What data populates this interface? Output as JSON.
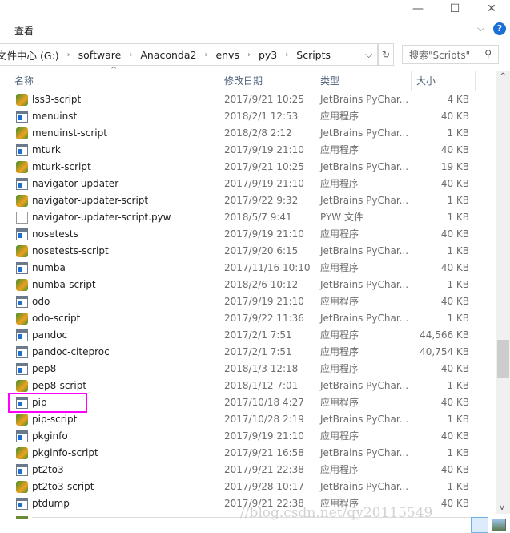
{
  "window": {
    "minimize": "—",
    "maximize": "☐",
    "close": "✕"
  },
  "ribbon": {
    "tab": "查看",
    "collapse": "⌵",
    "help": "?"
  },
  "address": {
    "crumbs": [
      "文件中心 (G:)",
      "software",
      "Anaconda2",
      "envs",
      "py3",
      "Scripts"
    ],
    "dropdown": "⌵",
    "refresh": "↻"
  },
  "search": {
    "placeholder": "搜索\"Scripts\""
  },
  "columns": {
    "name": "名称",
    "date": "修改日期",
    "type": "类型",
    "size": "大小"
  },
  "files": [
    {
      "name": "lss3-script",
      "date": "2017/9/21 10:25",
      "type": "JetBrains PyChar...",
      "size": "4 KB",
      "icon": "py"
    },
    {
      "name": "menuinst",
      "date": "2018/2/1 12:53",
      "type": "应用程序",
      "size": "40 KB",
      "icon": "exe"
    },
    {
      "name": "menuinst-script",
      "date": "2018/2/8 2:12",
      "type": "JetBrains PyChar...",
      "size": "1 KB",
      "icon": "py"
    },
    {
      "name": "mturk",
      "date": "2017/9/19 21:10",
      "type": "应用程序",
      "size": "40 KB",
      "icon": "exe"
    },
    {
      "name": "mturk-script",
      "date": "2017/9/21 10:25",
      "type": "JetBrains PyChar...",
      "size": "19 KB",
      "icon": "py"
    },
    {
      "name": "navigator-updater",
      "date": "2017/9/19 21:10",
      "type": "应用程序",
      "size": "40 KB",
      "icon": "exe"
    },
    {
      "name": "navigator-updater-script",
      "date": "2017/9/22 9:32",
      "type": "JetBrains PyChar...",
      "size": "1 KB",
      "icon": "py"
    },
    {
      "name": "navigator-updater-script.pyw",
      "date": "2018/5/7 9:41",
      "type": "PYW 文件",
      "size": "1 KB",
      "icon": "pyw"
    },
    {
      "name": "nosetests",
      "date": "2017/9/19 21:10",
      "type": "应用程序",
      "size": "40 KB",
      "icon": "exe"
    },
    {
      "name": "nosetests-script",
      "date": "2017/9/20 6:15",
      "type": "JetBrains PyChar...",
      "size": "1 KB",
      "icon": "py"
    },
    {
      "name": "numba",
      "date": "2017/11/16 10:10",
      "type": "应用程序",
      "size": "40 KB",
      "icon": "exe"
    },
    {
      "name": "numba-script",
      "date": "2018/2/6 10:12",
      "type": "JetBrains PyChar...",
      "size": "1 KB",
      "icon": "py"
    },
    {
      "name": "odo",
      "date": "2017/9/19 21:10",
      "type": "应用程序",
      "size": "40 KB",
      "icon": "exe"
    },
    {
      "name": "odo-script",
      "date": "2017/9/22 11:36",
      "type": "JetBrains PyChar...",
      "size": "1 KB",
      "icon": "py"
    },
    {
      "name": "pandoc",
      "date": "2017/2/1 7:51",
      "type": "应用程序",
      "size": "44,566 KB",
      "icon": "exe"
    },
    {
      "name": "pandoc-citeproc",
      "date": "2017/2/1 7:51",
      "type": "应用程序",
      "size": "40,754 KB",
      "icon": "exe"
    },
    {
      "name": "pep8",
      "date": "2018/1/3 12:18",
      "type": "应用程序",
      "size": "40 KB",
      "icon": "exe"
    },
    {
      "name": "pep8-script",
      "date": "2018/1/12 7:01",
      "type": "JetBrains PyChar...",
      "size": "1 KB",
      "icon": "py"
    },
    {
      "name": "pip",
      "date": "2017/10/18 4:27",
      "type": "应用程序",
      "size": "40 KB",
      "icon": "exe",
      "highlighted": true
    },
    {
      "name": "pip-script",
      "date": "2017/10/28 2:19",
      "type": "JetBrains PyChar...",
      "size": "1 KB",
      "icon": "py"
    },
    {
      "name": "pkginfo",
      "date": "2017/9/19 21:10",
      "type": "应用程序",
      "size": "40 KB",
      "icon": "exe"
    },
    {
      "name": "pkginfo-script",
      "date": "2017/9/21 16:58",
      "type": "JetBrains PyChar...",
      "size": "1 KB",
      "icon": "py"
    },
    {
      "name": "pt2to3",
      "date": "2017/9/21 22:38",
      "type": "应用程序",
      "size": "40 KB",
      "icon": "exe"
    },
    {
      "name": "pt2to3-script",
      "date": "2017/9/28 10:17",
      "type": "JetBrains PyChar...",
      "size": "1 KB",
      "icon": "py"
    },
    {
      "name": "ptdump",
      "date": "2017/9/21 22:38",
      "type": "应用程序",
      "size": "40 KB",
      "icon": "exe"
    }
  ],
  "watermark": "//blog.csdn.net/qy20115549",
  "colors": {
    "highlight": "#ff00ff",
    "header_text": "#4c607a"
  }
}
